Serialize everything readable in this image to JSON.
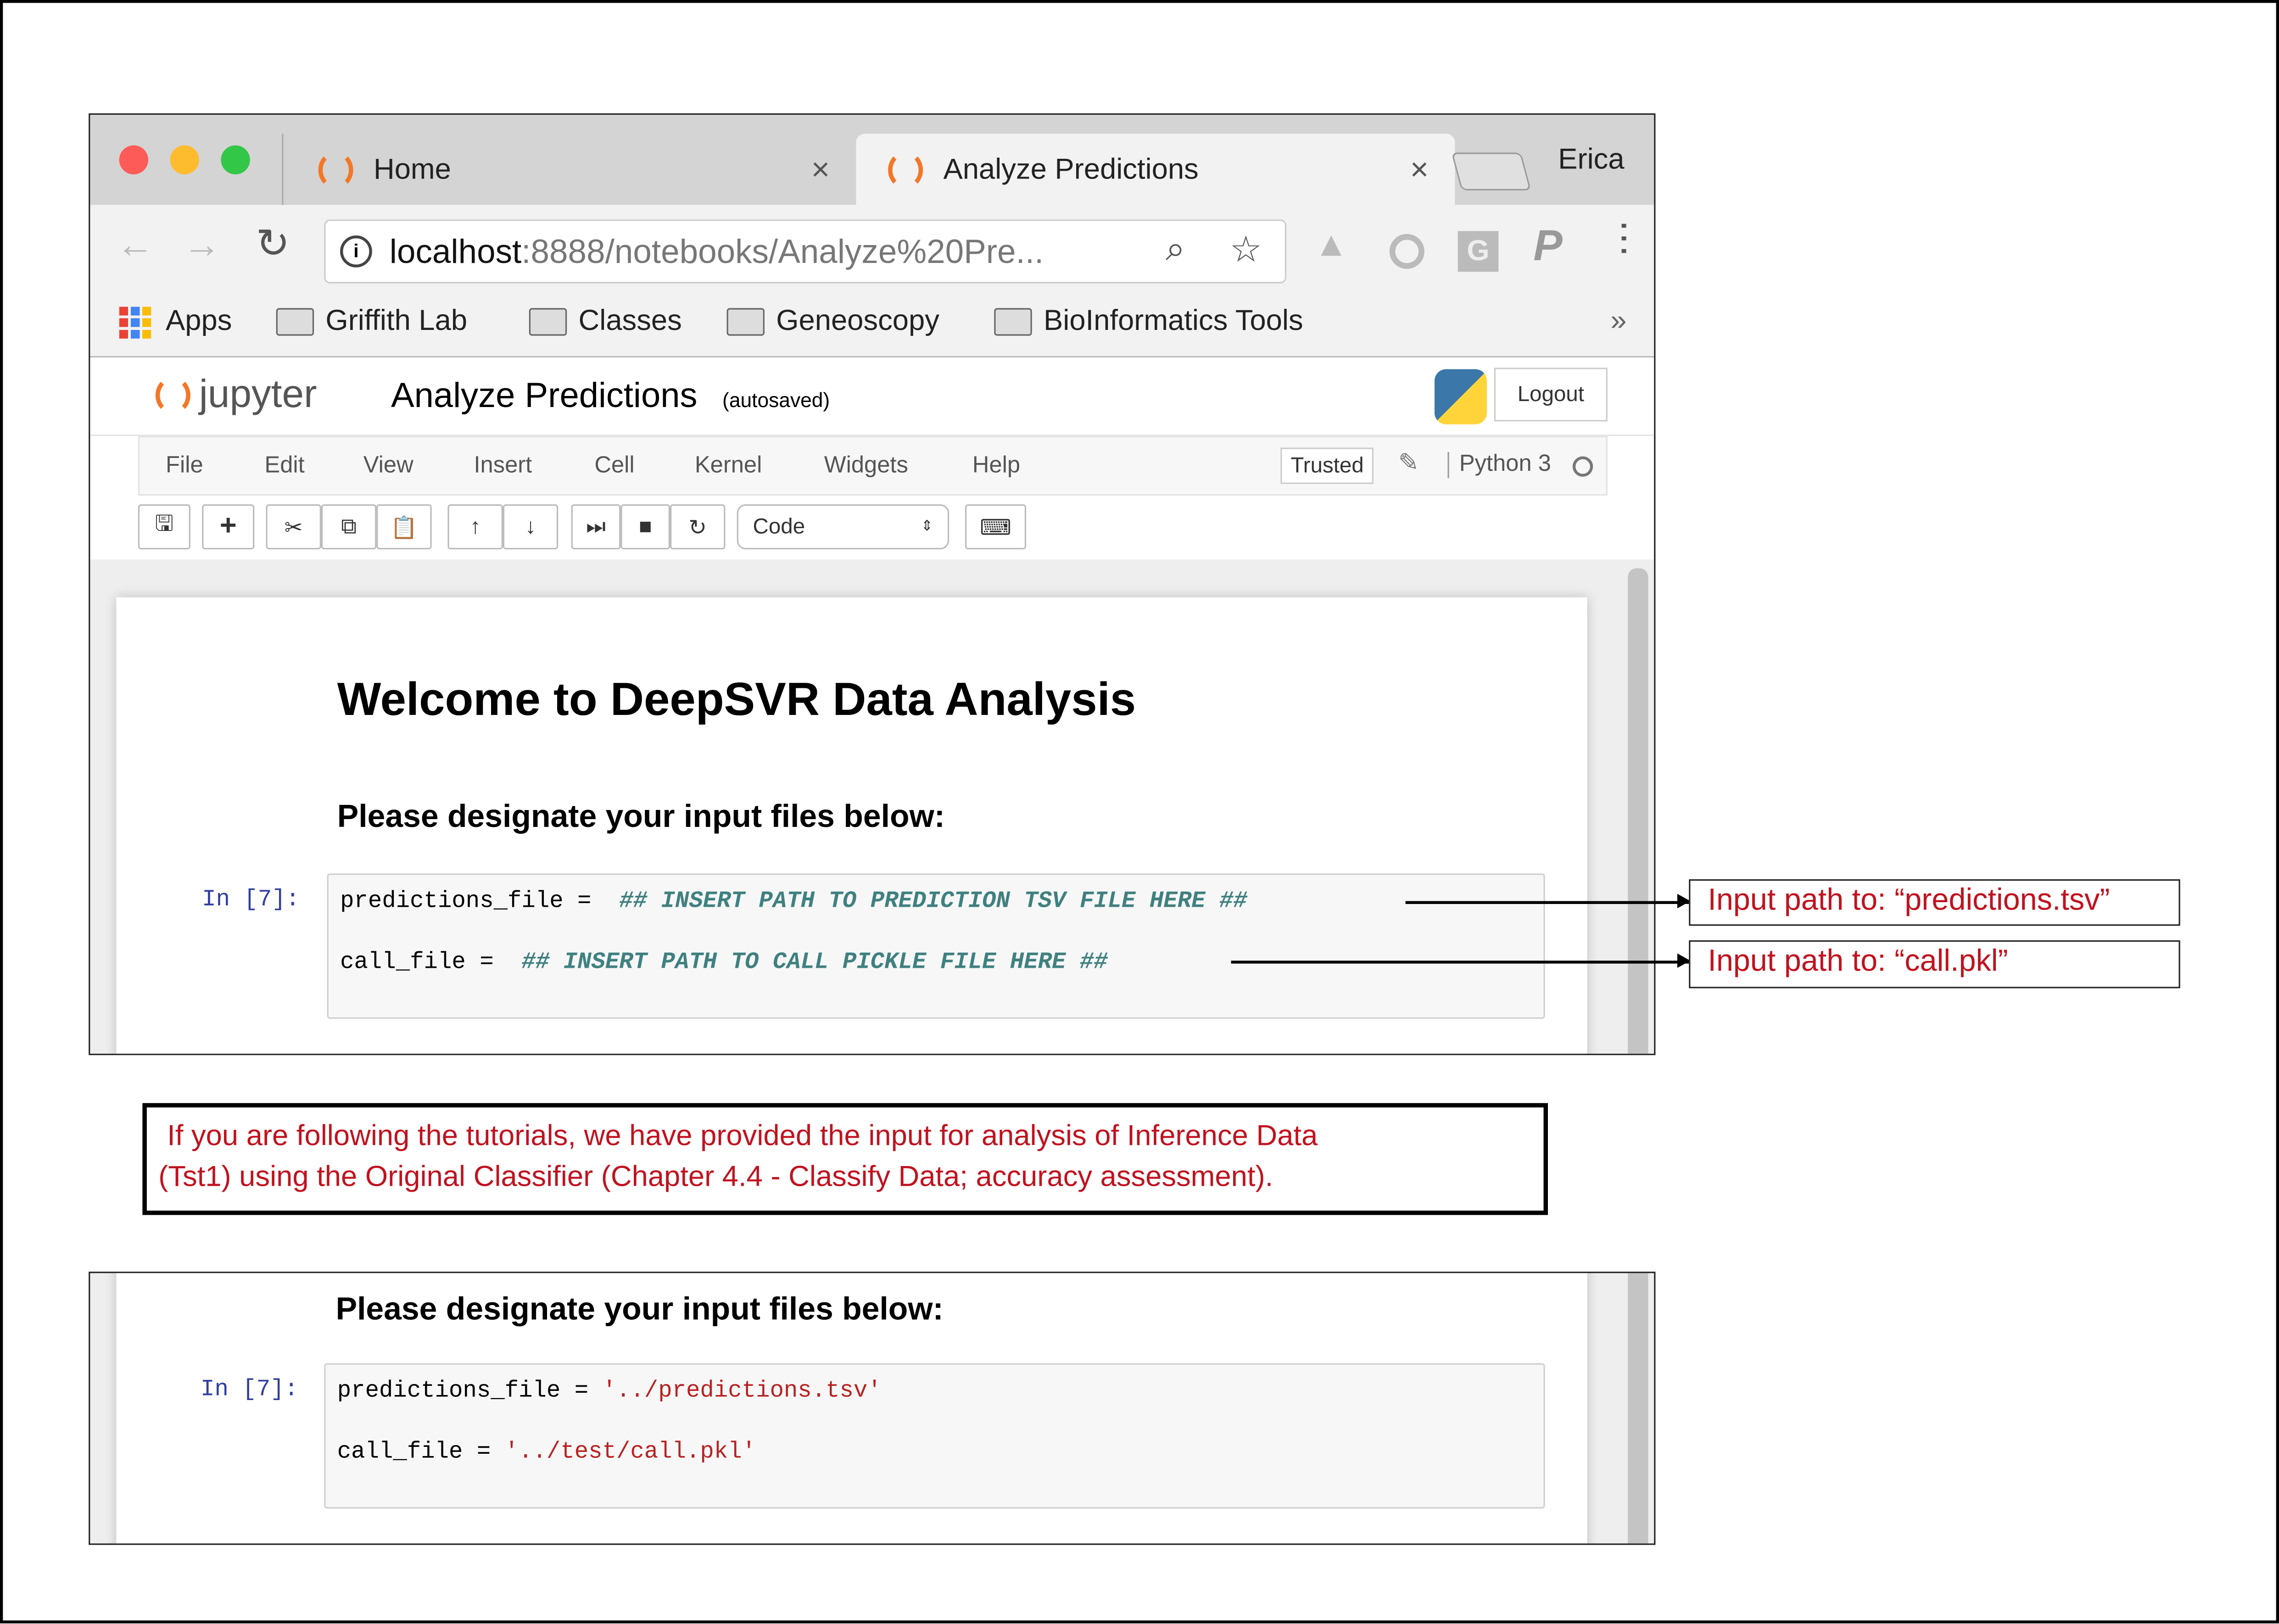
{
  "browser": {
    "tabs": [
      {
        "label": "Home",
        "active": false
      },
      {
        "label": "Analyze Predictions",
        "active": true
      }
    ],
    "profile_name": "Erica",
    "address": {
      "host": "localhost",
      "path": ":8888/notebooks/Analyze%20Pre..."
    },
    "bookmarks": [
      "Apps",
      "Griffith Lab",
      "Classes",
      "Geneoscopy",
      "BioInformatics Tools"
    ],
    "bookmarks_overflow": "»",
    "extension_icons": [
      "google-drive-icon",
      "circle-extension-icon",
      "grammarly-g-icon",
      "paypal-p-icon"
    ]
  },
  "jupyter": {
    "logo_text": "jupyter",
    "notebook_name": "Analyze Predictions",
    "save_status": "(autosaved)",
    "logout_label": "Logout",
    "menu": [
      "File",
      "Edit",
      "View",
      "Insert",
      "Cell",
      "Kernel",
      "Widgets",
      "Help"
    ],
    "trusted_label": "Trusted",
    "kernel_name": "Python 3",
    "cell_type": "Code",
    "accent": "#f37726"
  },
  "notebook": {
    "title": "Welcome to DeepSVR Data Analysis",
    "subheading": "Please designate your input files below:",
    "prompt": "In [7]:",
    "cell_before": {
      "line1_var": "predictions_file = ",
      "line1_comment": "## INSERT PATH TO PREDICTION TSV FILE HERE ##",
      "line2_var": "call_file = ",
      "line2_comment": "## INSERT PATH TO CALL PICKLE FILE HERE ##"
    },
    "cell_after": {
      "line1_var": "predictions_file = ",
      "line1_value": "'../predictions.tsv'",
      "line2_var": "call_file = ",
      "line2_value": "'../test/call.pkl'"
    }
  },
  "annotations": {
    "predictions": "Input path to: “predictions.tsv”",
    "call": "Input path to: “call.pkl”",
    "note_line1": "If you are following the tutorials, we have provided the input for analysis of Inference Data",
    "note_line2": "(Tst1) using the Original Classifier (Chapter 4.4 - Classify Data; accuracy assessment).",
    "color": "#c1121f"
  }
}
